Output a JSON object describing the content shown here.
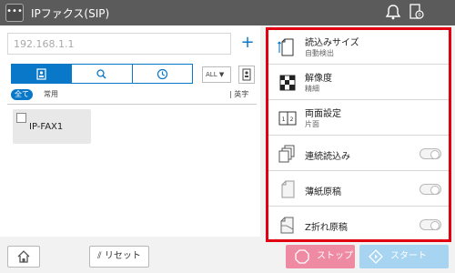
{
  "header": {
    "menu_icon": "more-icon",
    "title": "IPファクス(SIP)"
  },
  "left_panel": {
    "address_value": "192.168.1.1",
    "address_add": "+",
    "tabs": [
      "address-book-icon",
      "search-icon",
      "history-icon"
    ],
    "filter": "ALL",
    "categories": [
      "全て",
      "常用",
      "英字"
    ],
    "entries": [
      {
        "name": "IP-FAX1"
      }
    ]
  },
  "settings": [
    {
      "name": "読込みサイズ",
      "value": "自動検出",
      "icon": "scan-size-icon"
    },
    {
      "name": "解像度",
      "value": "精細",
      "icon": "resolution-icon"
    },
    {
      "name": "両面設定",
      "value": "片面",
      "icon": "duplex-icon"
    },
    {
      "name": "連続読込み",
      "toggle": "off",
      "icon": "continuous-scan-icon"
    },
    {
      "name": "薄紙原稿",
      "toggle": "off",
      "icon": "thin-paper-icon"
    },
    {
      "name": "Z折れ原稿",
      "toggle": "off",
      "icon": "z-fold-icon"
    }
  ],
  "bottom": {
    "reset": "リセット",
    "stop": "ストップ",
    "start": "スタート"
  },
  "colors": {
    "accent": "#0a78c8",
    "highlight": "#e00012",
    "stop": "#ef8aa3",
    "start": "#a7d4f1"
  }
}
